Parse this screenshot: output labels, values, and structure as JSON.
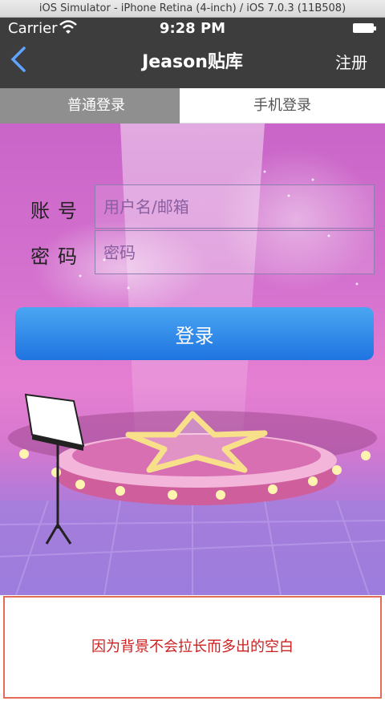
{
  "simulator": {
    "title": "iOS Simulator - iPhone Retina (4-inch) / iOS 7.0.3 (11B508)"
  },
  "status_bar": {
    "carrier": "Carrier",
    "time": "9:28 PM"
  },
  "nav": {
    "title": "Jeason贴库",
    "register_label": "注册"
  },
  "tabs": [
    {
      "label": "普通登录",
      "selected": true
    },
    {
      "label": "手机登录",
      "selected": false
    }
  ],
  "form": {
    "account_label": "账号",
    "account_placeholder": "用户名/邮箱",
    "password_label": "密码",
    "password_placeholder": "密码",
    "login_label": "登录"
  },
  "annotation": {
    "text": "因为背景不会拉长而多出的空白"
  },
  "colors": {
    "nav_bg": "#3d3d3d",
    "button": "#2a85e8",
    "annotation_text": "#cc1f1f",
    "annotation_border": "#e36b57"
  }
}
